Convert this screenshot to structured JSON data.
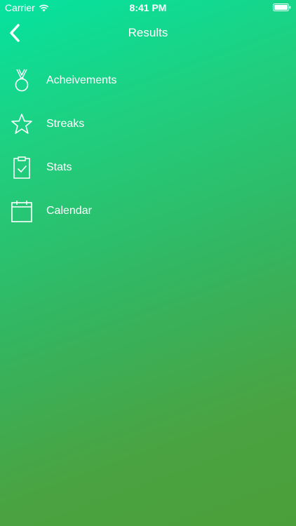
{
  "status_bar": {
    "carrier": "Carrier",
    "time": "8:41 PM",
    "icons": [
      "wifi-icon",
      "battery-icon"
    ]
  },
  "nav": {
    "back_icon": "chevron-left-icon",
    "title": "Results"
  },
  "menu": {
    "items": [
      {
        "label": "Acheivements",
        "icon": "medal-icon"
      },
      {
        "label": "Streaks",
        "icon": "star-icon"
      },
      {
        "label": "Stats",
        "icon": "clipboard-check-icon"
      },
      {
        "label": "Calendar",
        "icon": "calendar-icon"
      }
    ]
  },
  "colors": {
    "gradient_top": "#05e3a0",
    "gradient_bottom": "#4b9f3a",
    "foreground": "#ffffff"
  }
}
